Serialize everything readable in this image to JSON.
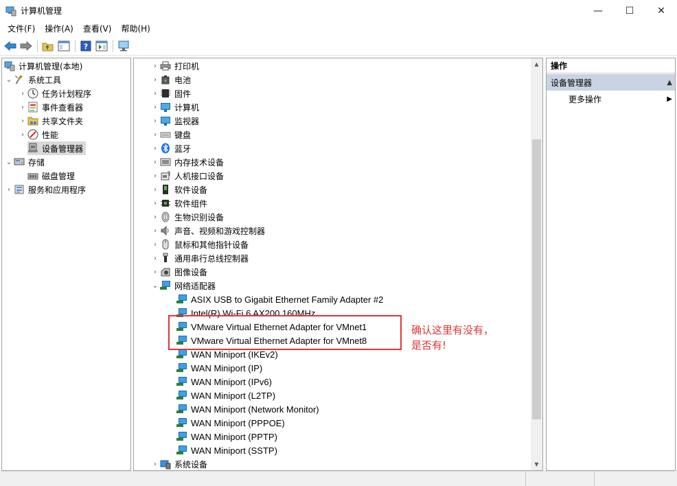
{
  "window": {
    "title": "计算机管理",
    "minimize": "—",
    "maximize": "☐",
    "close": "✕"
  },
  "menu": [
    "文件(F)",
    "操作(A)",
    "查看(V)",
    "帮助(H)"
  ],
  "toolbar": [
    "back-arrow-icon",
    "forward-arrow-icon",
    "up-folder-icon",
    "show-hide-tree-icon",
    "help-icon",
    "show-hide-action-pane-icon",
    "monitor-icon"
  ],
  "left_tree": {
    "root": "计算机管理(本地)",
    "system_tools": "系统工具",
    "task_scheduler": "任务计划程序",
    "event_viewer": "事件查看器",
    "shared_folders": "共享文件夹",
    "performance": "性能",
    "device_manager": "设备管理器",
    "storage": "存储",
    "disk_management": "磁盘管理",
    "services_apps": "服务和应用程序"
  },
  "devices": {
    "categories": [
      "打印机",
      "电池",
      "固件",
      "计算机",
      "监视器",
      "键盘",
      "蓝牙",
      "内存技术设备",
      "人机接口设备",
      "软件设备",
      "软件组件",
      "生物识别设备",
      "声音、视频和游戏控制器",
      "鼠标和其他指针设备",
      "通用串行总线控制器",
      "图像设备",
      "网络适配器"
    ],
    "network_adapters": [
      "ASIX USB to Gigabit Ethernet Family Adapter #2",
      "Intel(R) Wi-Fi 6 AX200 160MHz",
      "VMware Virtual Ethernet Adapter for VMnet1",
      "VMware Virtual Ethernet Adapter for VMnet8",
      "WAN Miniport (IKEv2)",
      "WAN Miniport (IP)",
      "WAN Miniport (IPv6)",
      "WAN Miniport (L2TP)",
      "WAN Miniport (Network Monitor)",
      "WAN Miniport (PPPOE)",
      "WAN Miniport (PPTP)",
      "WAN Miniport (SSTP)"
    ],
    "last_category": "系统设备"
  },
  "actions": {
    "header": "操作",
    "section": "设备管理器",
    "more": "更多操作"
  },
  "annotation": {
    "line1": "确认这里有没有，",
    "line2": "是否有!",
    "color": "#e03535"
  }
}
